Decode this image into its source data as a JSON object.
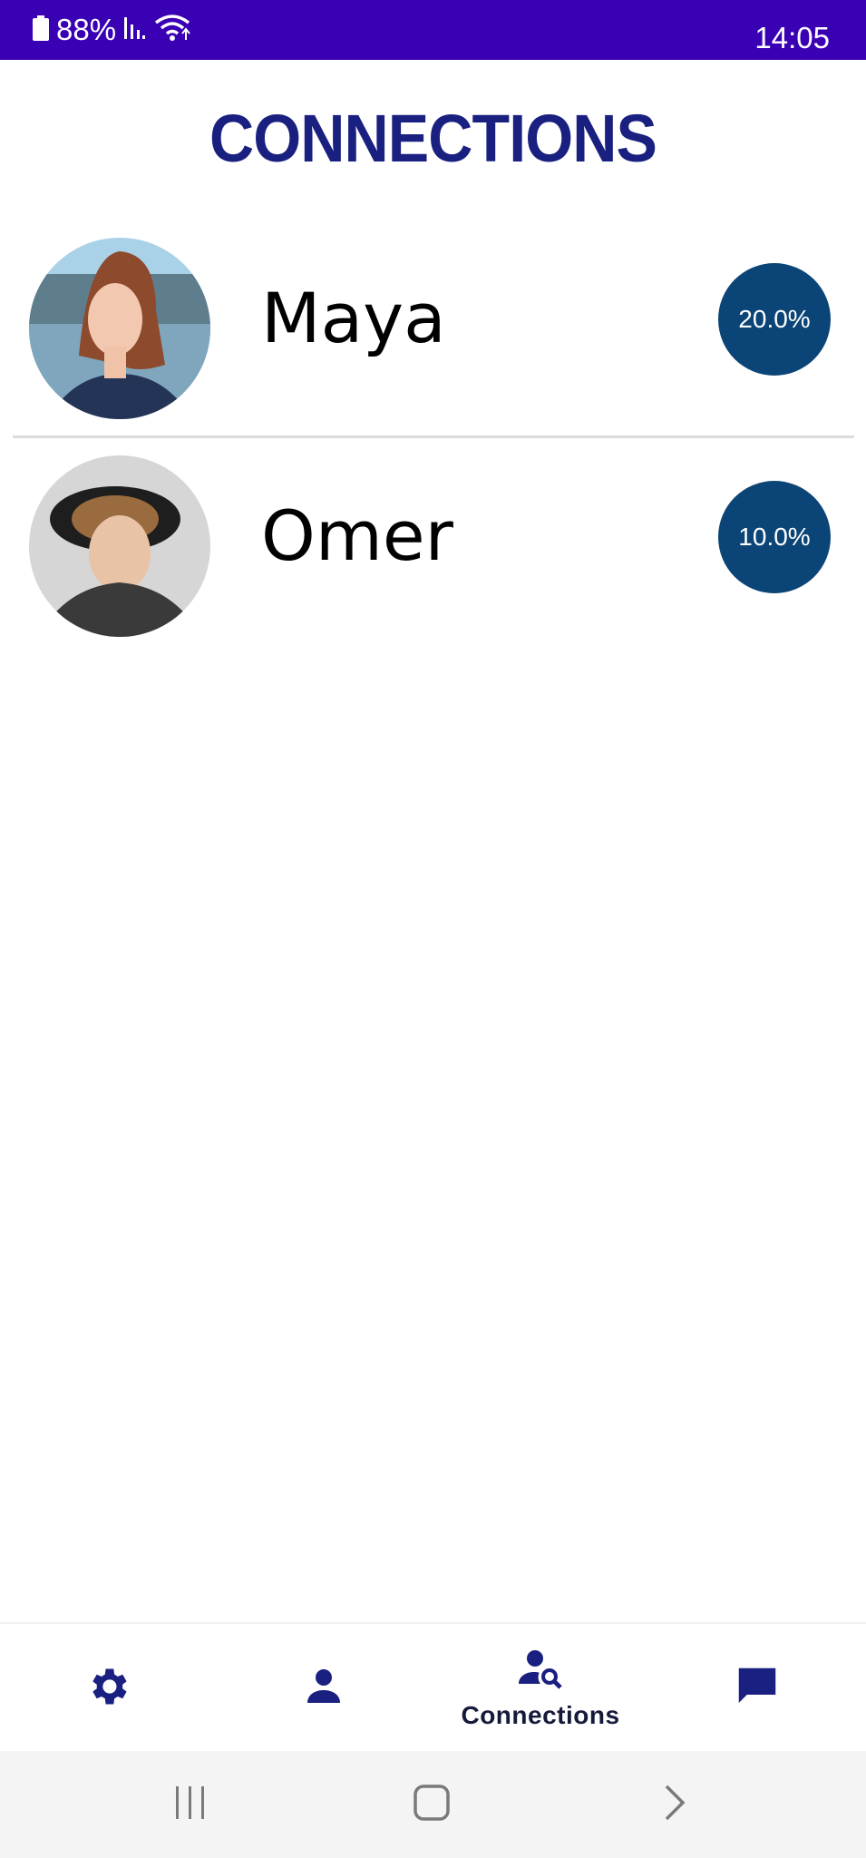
{
  "status_bar": {
    "battery": "88%",
    "time": "14:05",
    "icons": [
      "battery-icon",
      "signal-icon",
      "wifi-icon"
    ]
  },
  "page": {
    "title": "CONNECTIONS"
  },
  "connections": [
    {
      "name": "Maya",
      "match": "20.0%",
      "avatar": "photo of woman with red bob haircut by a lake"
    },
    {
      "name": "Omer",
      "match": "10.0%",
      "avatar": "photo of young man with curly hair and black hat"
    }
  ],
  "bottom_nav": {
    "items": [
      {
        "icon": "gear-icon",
        "label": ""
      },
      {
        "icon": "person-icon",
        "label": ""
      },
      {
        "icon": "person-search-icon",
        "label": "Connections"
      },
      {
        "icon": "chat-icon",
        "label": ""
      }
    ],
    "active_index": 2
  },
  "system_nav": {
    "buttons": [
      "recents-icon",
      "home-icon",
      "back-icon"
    ]
  },
  "colors": {
    "status_bar": "#3a00b4",
    "title": "#1a2080",
    "badge": "#0b4476",
    "nav_icon": "#1a2080"
  }
}
